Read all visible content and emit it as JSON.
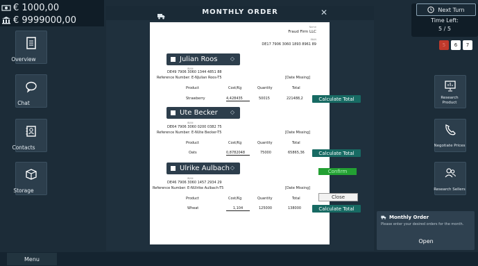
{
  "balances": {
    "cash": "€ 1000,00",
    "bank": "€ 9999000,00"
  },
  "left_nav": [
    {
      "label": "Overview",
      "icon": "document-icon"
    },
    {
      "label": "Chat",
      "icon": "chat-bubble-icon"
    },
    {
      "label": "Contacts",
      "icon": "contacts-icon"
    },
    {
      "label": "Storage",
      "icon": "box-icon"
    }
  ],
  "right_nav": [
    {
      "label": "Research\nProduct",
      "icon": "research-product-icon"
    },
    {
      "label": "Negotiate Prices",
      "icon": "phone-icon"
    },
    {
      "label": "Research Sellers",
      "icon": "people-icon"
    }
  ],
  "turn": {
    "next_label": "Next Turn",
    "time_left_label": "Time Left:",
    "time_left_value": "5 / 5",
    "turn_numbers": [
      "5",
      "6",
      "7"
    ]
  },
  "modal": {
    "title": "MONTHLY ORDER",
    "buyer_name_label": "Name",
    "buyer_name": "Fraud Firm LLC",
    "buyer_iban_label": "IBAN",
    "buyer_iban": "DE17 7906 3060 1893 8961 89",
    "orders": [
      {
        "seller": "Julian Roos",
        "iban_label": "IBAN",
        "iban": "DE49 7906 3060 1344 4851 88",
        "reference": "Reference Number: E-NJulian Roos-T5",
        "date": "[Date Missing]",
        "product_header": "Product",
        "cost_header": "Cost/Kg",
        "qty_header": "Quantity",
        "total_header": "Total",
        "product": "Strawberry",
        "cost": "4,428435",
        "qty": "50015",
        "total": "221488,2",
        "calc_label": "Calculate Total"
      },
      {
        "seller": "Ute Becker",
        "iban_label": "IBAN",
        "iban": "DE64 7906 3060 0200 0382 75",
        "reference": "Reference Number: E-NUte Becker-T5",
        "date": "[Date Missing]",
        "product_header": "Product",
        "cost_header": "Cost/Kg",
        "qty_header": "Quantity",
        "total_header": "Total",
        "product": "Oats",
        "cost": "0,8782048",
        "qty": "75000",
        "total": "65865,36",
        "calc_label": "Calculate Total"
      },
      {
        "seller": "Ulrike Aulbach",
        "iban_label": "IBAN",
        "iban": "DE46 7906 3060 1457 2934 29",
        "reference": "Reference Number: E-NUlrike Aulbach-T5",
        "date": "[Date Missing]",
        "product_header": "Product",
        "cost_header": "Cost/Kg",
        "qty_header": "Quantity",
        "total_header": "Total",
        "product": "Wheat",
        "cost": "1,104",
        "qty": "125000",
        "total": "138000",
        "calc_label": "Calculate Total"
      }
    ],
    "confirm_label": "Confirm",
    "close_label": "Close"
  },
  "notification": {
    "title": "Monthly Order",
    "body": "Please enter your desired orders for the month.",
    "open_label": "Open"
  },
  "bottom": {
    "menu_label": "Menu"
  },
  "colors": {
    "bg": "#1c2c38",
    "teal": "#176a63",
    "green": "#23a033",
    "red": "#c0392b"
  }
}
